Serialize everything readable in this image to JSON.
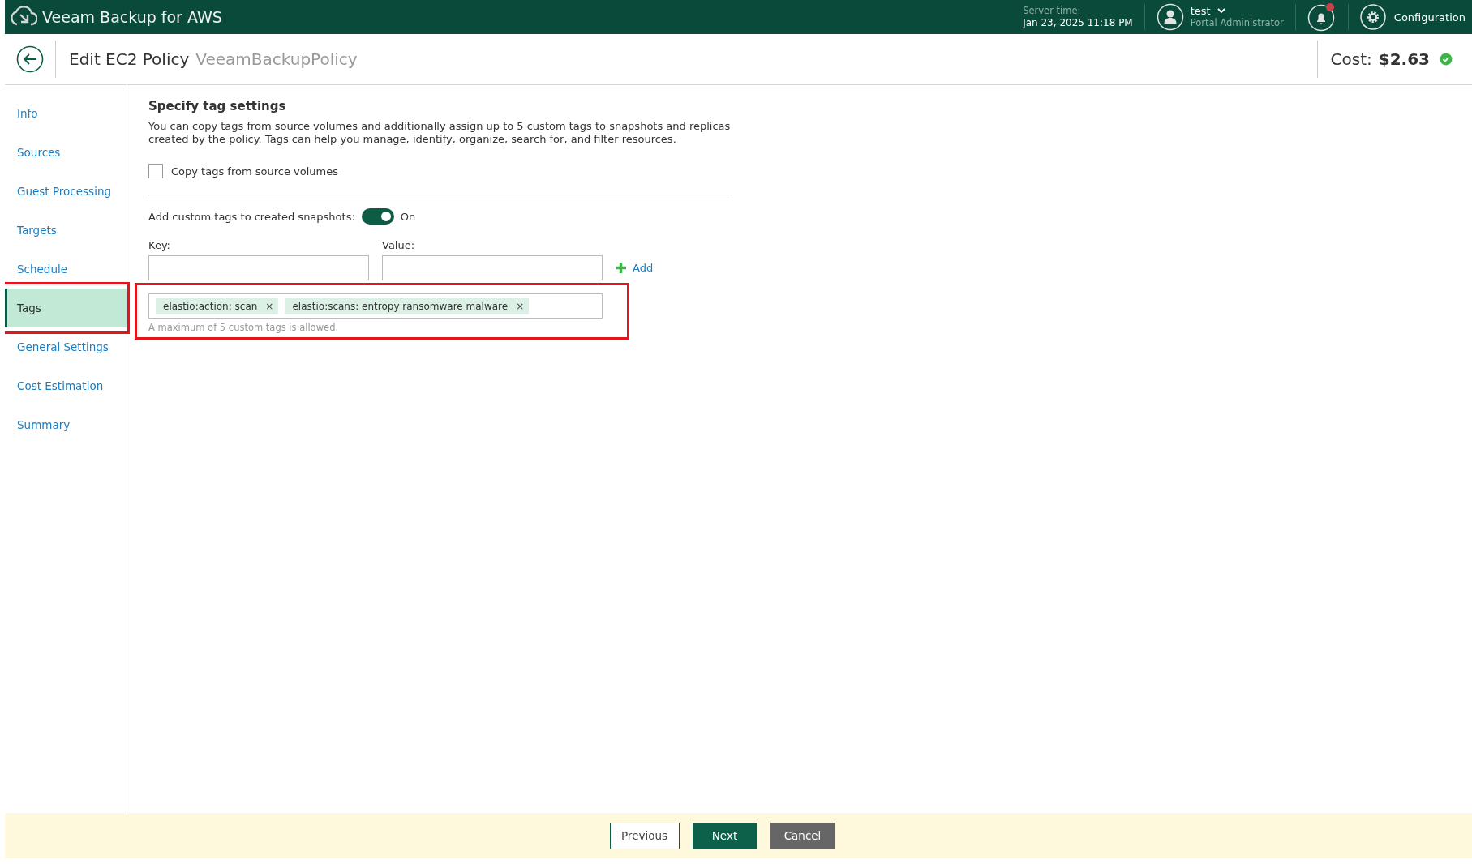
{
  "app": {
    "title": "Veeam Backup for AWS",
    "server_time_label": "Server time:",
    "server_time": "Jan 23, 2025 11:18 PM",
    "user": {
      "name": "test",
      "role": "Portal Administrator"
    },
    "notifications": {
      "unread": true
    },
    "configuration": "Configuration"
  },
  "header": {
    "title": "Edit EC2 Policy",
    "policy_name": "VeeamBackupPolicy",
    "cost_label": "Cost:",
    "cost": "$2.63"
  },
  "sidebar": {
    "items": [
      {
        "label": "Info",
        "selected": false,
        "highlighted": false
      },
      {
        "label": "Sources",
        "selected": false,
        "highlighted": false
      },
      {
        "label": "Guest Processing",
        "selected": false,
        "highlighted": false
      },
      {
        "label": "Targets",
        "selected": false,
        "highlighted": false
      },
      {
        "label": "Schedule",
        "selected": false,
        "highlighted": false
      },
      {
        "label": "Tags",
        "selected": true,
        "highlighted": true
      },
      {
        "label": "General Settings",
        "selected": false,
        "highlighted": false
      },
      {
        "label": "Cost Estimation",
        "selected": false,
        "highlighted": false
      },
      {
        "label": "Summary",
        "selected": false,
        "highlighted": false
      }
    ]
  },
  "form": {
    "heading": "Specify tag settings",
    "description": "You can copy tags from source volumes and additionally assign up to 5 custom tags to snapshots and replicas created by the policy. Tags can help you manage, identify, organize, search for, and filter resources.",
    "copy_tags": {
      "label": "Copy tags from source volumes",
      "checked": false
    },
    "custom_tags": {
      "label": "Add custom tags to created snapshots:",
      "on": true,
      "state_text": "On"
    },
    "key": {
      "label": "Key:"
    },
    "value": {
      "label": "Value:"
    },
    "add": "Add",
    "tags": [
      {
        "text": "elastio:action: scan",
        "remove": "×"
      },
      {
        "text": "elastio:scans: entropy ransomware malware",
        "remove": "×"
      }
    ],
    "tags_highlighted": true,
    "hint": "A maximum of 5 custom tags is allowed."
  },
  "footer": {
    "buttons": [
      {
        "label": "Previous",
        "kind": "secondary"
      },
      {
        "label": "Next",
        "kind": "primary"
      },
      {
        "label": "Cancel",
        "kind": "cancel"
      }
    ]
  }
}
